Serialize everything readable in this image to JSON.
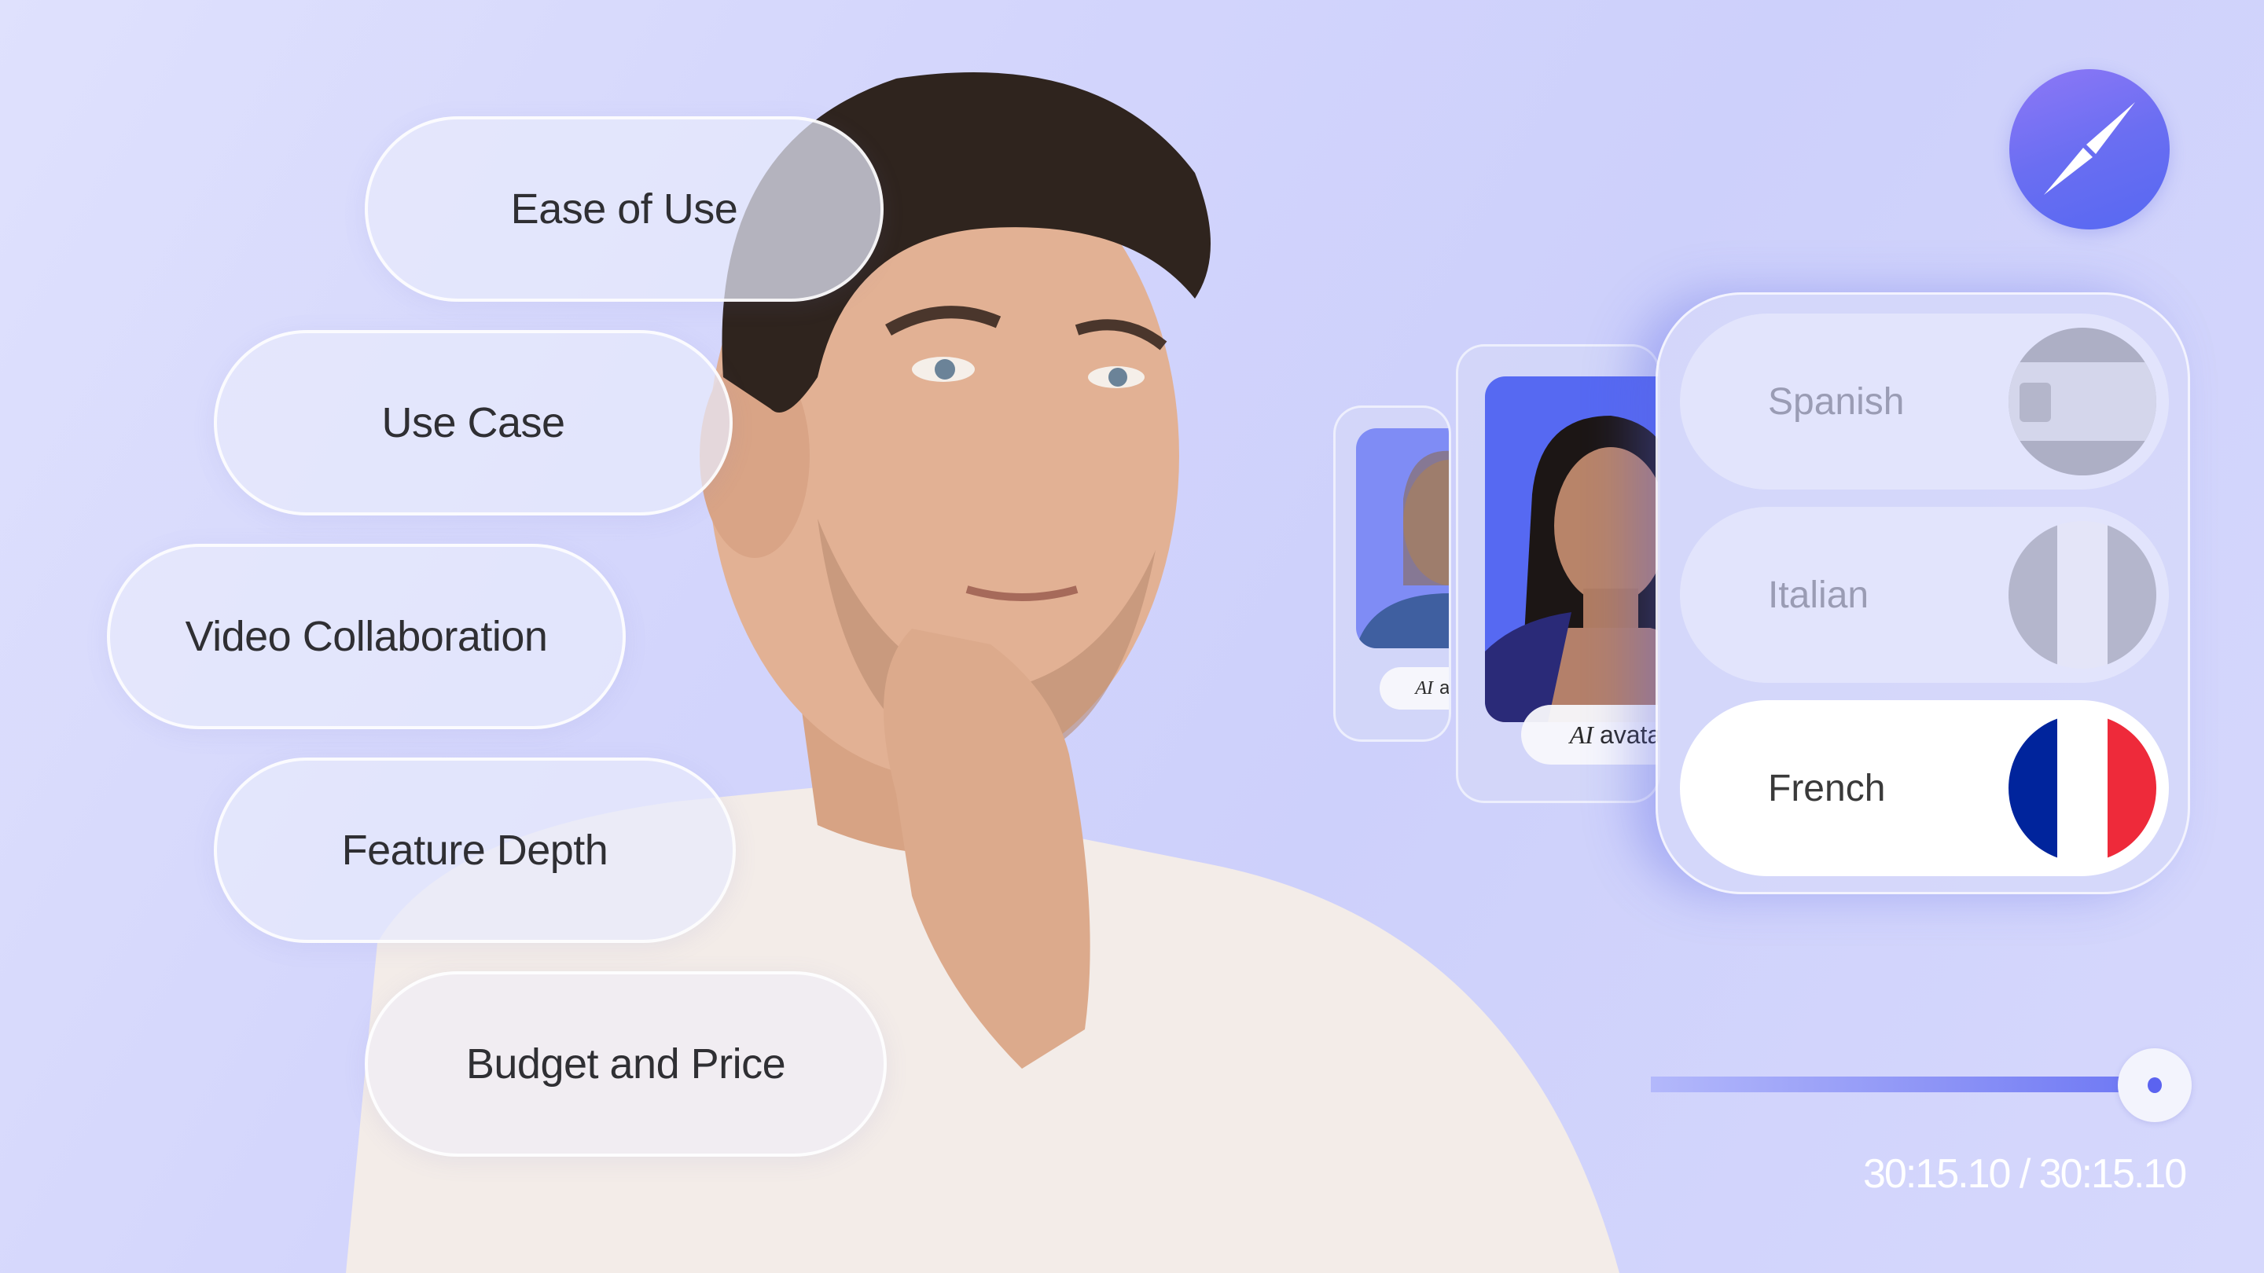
{
  "criteria_pills": [
    {
      "label": "Ease of Use"
    },
    {
      "label": "Use Case"
    },
    {
      "label": "Video Collaboration"
    },
    {
      "label": "Feature Depth"
    },
    {
      "label": "Budget and Price"
    }
  ],
  "compass_button": {
    "icon": "compass-icon",
    "color": "#6a6ef2"
  },
  "avatar_cards": [
    {
      "tag_italic": "AI",
      "tag_text": "ava"
    },
    {
      "tag_italic": "AI",
      "tag_text": "avata"
    }
  ],
  "languages": [
    {
      "label": "Spanish",
      "flag": "spain-flag-icon",
      "state": "inactive"
    },
    {
      "label": "Italian",
      "flag": "italy-flag-icon",
      "state": "inactive"
    },
    {
      "label": "French",
      "flag": "france-flag-icon",
      "state": "selected"
    }
  ],
  "player": {
    "progress": 1.0,
    "time_text": "30:15.10 / 30:15.10",
    "accent": "#5b63f0"
  },
  "colors": {
    "background": "#d3d5fc",
    "france_blue": "#00249c",
    "france_red": "#ee2a3a"
  }
}
